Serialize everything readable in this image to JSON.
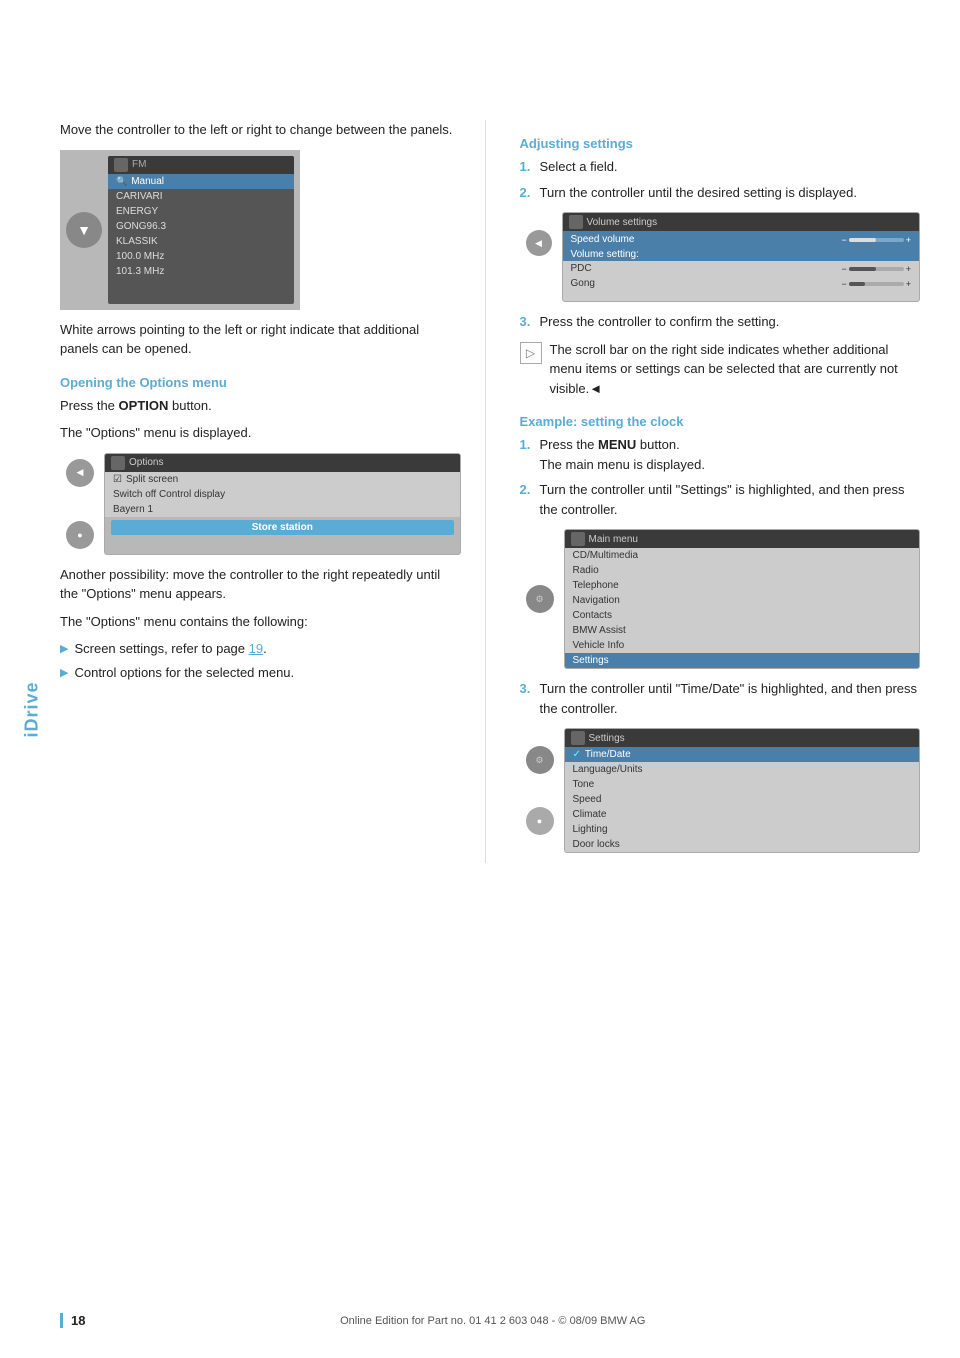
{
  "sidebar": {
    "label": "iDrive"
  },
  "left_col": {
    "intro_text": "Move the controller to the left or right to change between the panels.",
    "fm_screen": {
      "header": "FM",
      "rows": [
        {
          "label": "Manual",
          "type": "search-highlighted"
        },
        {
          "label": "CARIVARI",
          "type": "normal"
        },
        {
          "label": "ENERGY",
          "type": "normal"
        },
        {
          "label": "GONG96.3",
          "type": "normal"
        },
        {
          "label": "KLASSIK",
          "type": "normal"
        },
        {
          "label": "100.0 MHz",
          "type": "normal"
        },
        {
          "label": "101.3 MHz",
          "type": "normal"
        }
      ]
    },
    "white_arrows_text": "White arrows pointing to the left or right indicate that additional panels can be opened.",
    "options_heading": "Opening the Options menu",
    "options_para1": "Press the ",
    "options_bold": "OPTION",
    "options_para1_end": " button.",
    "options_para2": "The \"Options\" menu is displayed.",
    "options_screen": {
      "header": "Options",
      "rows": [
        {
          "label": "Split screen",
          "type": "check"
        },
        {
          "label": "Switch off Control display",
          "type": "normal"
        },
        {
          "label": "Bayern 1",
          "type": "normal"
        },
        {
          "label": "Store station",
          "type": "button"
        }
      ]
    },
    "another_possibility": "Another possibility: move the controller to the right repeatedly until the \"Options\" menu appears.",
    "options_contains": "The \"Options\" menu contains the following:",
    "bullet_items": [
      {
        "text": "Screen settings, refer to page ",
        "link": "19",
        "after": "."
      },
      {
        "text": "Control options for the selected menu.",
        "link": "",
        "after": ""
      }
    ]
  },
  "right_col": {
    "adjusting_heading": "Adjusting settings",
    "adjusting_steps": [
      {
        "num": "1.",
        "text": "Select a field."
      },
      {
        "num": "2.",
        "text": "Turn the controller until the desired setting is displayed."
      }
    ],
    "volume_screen": {
      "header": "Volume settings",
      "speed_volume_label": "Speed volume",
      "volume_setting_label": "Volume setting:",
      "rows": [
        {
          "label": "PDC",
          "fill": 50
        },
        {
          "label": "Gong",
          "fill": 30
        }
      ]
    },
    "step3_text": "Press the controller to confirm the setting.",
    "scroll_indicator_text": "The scroll bar on the right side indicates whether additional menu items or settings can be selected that are currently not visible.◄",
    "example_heading": "Example: setting the clock",
    "example_steps": [
      {
        "num": "1.",
        "text": "Press the ",
        "bold": "MENU",
        "text2": " button.\nThe main menu is displayed."
      },
      {
        "num": "2.",
        "text": "Turn the controller until \"Settings\" is highlighted, and then press the controller."
      }
    ],
    "main_menu_screen": {
      "header": "Main menu",
      "rows": [
        {
          "label": "CD/Multimedia",
          "type": "normal"
        },
        {
          "label": "Radio",
          "type": "normal"
        },
        {
          "label": "Telephone",
          "type": "normal"
        },
        {
          "label": "Navigation",
          "type": "normal"
        },
        {
          "label": "Contacts",
          "type": "normal"
        },
        {
          "label": "BMW Assist",
          "type": "normal"
        },
        {
          "label": "Vehicle Info",
          "type": "normal"
        },
        {
          "label": "Settings",
          "type": "active"
        }
      ]
    },
    "step3b_text": "Turn the controller until \"Time/Date\" is highlighted, and then press the controller.",
    "settings_screen": {
      "header": "Settings",
      "rows": [
        {
          "label": "Time/Date",
          "type": "active",
          "check": true
        },
        {
          "label": "Language/Units",
          "type": "normal"
        },
        {
          "label": "Tone",
          "type": "normal"
        },
        {
          "label": "Speed",
          "type": "normal"
        },
        {
          "label": "Climate",
          "type": "normal"
        },
        {
          "label": "Lighting",
          "type": "normal"
        },
        {
          "label": "Door locks",
          "type": "normal"
        }
      ]
    }
  },
  "footer": {
    "page_num": "18",
    "copyright": "Online Edition for Part no. 01 41 2 603 048 - © 08/09 BMW AG"
  }
}
